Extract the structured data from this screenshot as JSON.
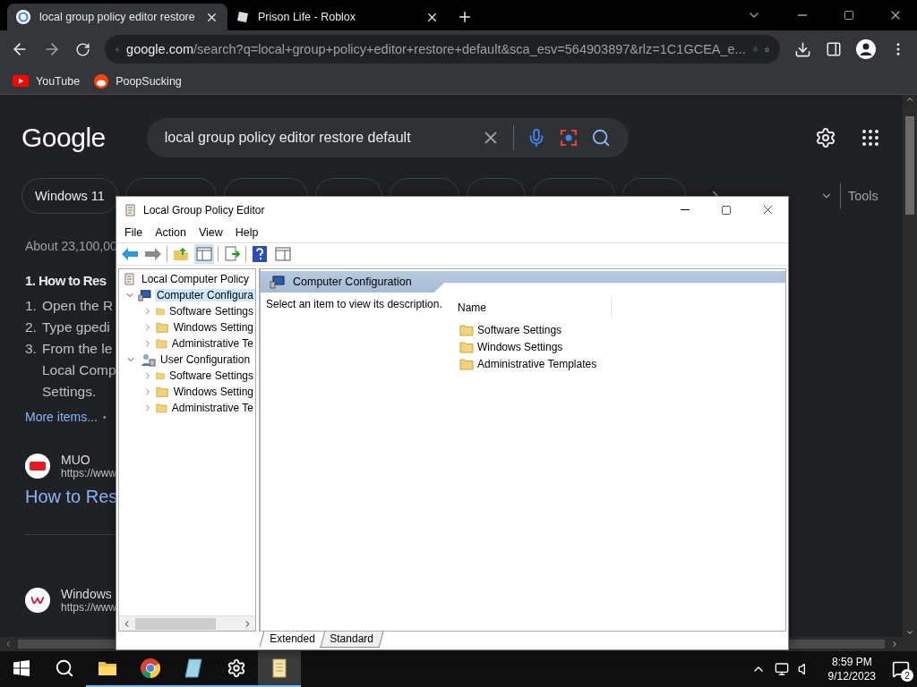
{
  "browser": {
    "tabs": [
      {
        "title": "local group policy editor restore",
        "selected": true
      },
      {
        "title": "Prison Life - Roblox",
        "selected": false
      }
    ],
    "address": {
      "host": "google.com",
      "path": "/search?q=local+group+policy+editor+restore+default&sca_esv=564903897&rlz=1C1GCEA_e..."
    },
    "bookmarks": [
      {
        "label": "YouTube",
        "kind": "youtube"
      },
      {
        "label": "PoopSucking",
        "kind": "reddit"
      }
    ]
  },
  "google": {
    "logo": "Google",
    "query": "local group policy editor restore default",
    "chips": [
      {
        "label": "Windows 11"
      }
    ],
    "tools": "Tools",
    "result_stats": "About 23,100,00",
    "snippet_title": "1. How to Res",
    "steps": [
      {
        "number": "1.",
        "lines": [
          "Open the R"
        ]
      },
      {
        "number": "2.",
        "lines": [
          "Type gpedi"
        ]
      },
      {
        "number": "3.",
        "lines": [
          "From the le",
          "Local Comp",
          "Settings."
        ]
      }
    ],
    "more_items": "More items...",
    "separator": "•",
    "results": [
      {
        "site": "MUO",
        "url": "https://www",
        "title": "How to Res",
        "kind": "muo"
      },
      {
        "site": "Windows",
        "url": "https://www",
        "kind": "windows"
      }
    ]
  },
  "gpe": {
    "title": "Local Group Policy Editor",
    "menu": [
      "File",
      "Action",
      "View",
      "Help"
    ],
    "tree": [
      {
        "label": "Local Computer Policy",
        "kind": "policy",
        "children": [
          {
            "label": "Computer Configura",
            "kind": "computer",
            "expanded": true,
            "selected": true,
            "children": [
              {
                "label": "Software Settings",
                "kind": "folder",
                "expanded": false,
                "selected": false
              },
              {
                "label": "Windows Setting",
                "kind": "folder",
                "expanded": false,
                "selected": false
              },
              {
                "label": "Administrative Te",
                "kind": "folder",
                "expanded": false,
                "selected": false
              }
            ]
          },
          {
            "label": "User Configuration",
            "kind": "user",
            "expanded": true,
            "selected": false,
            "children": [
              {
                "label": "Software Settings",
                "kind": "folder",
                "expanded": false,
                "selected": false
              },
              {
                "label": "Windows Setting",
                "kind": "folder",
                "expanded": false,
                "selected": false
              },
              {
                "label": "Administrative Te",
                "kind": "folder",
                "expanded": false,
                "selected": false
              }
            ]
          }
        ]
      }
    ],
    "details_title": "Computer Configuration",
    "description": "Select an item to view its description.",
    "column": "Name",
    "items": [
      "Software Settings",
      "Windows Settings",
      "Administrative Templates"
    ],
    "view_tabs": [
      {
        "label": "Extended",
        "selected": true
      },
      {
        "label": "Standard",
        "selected": false
      }
    ]
  },
  "taskbar": {
    "apps": [
      {
        "kind": "explorer",
        "running": true,
        "active": false
      },
      {
        "kind": "chrome",
        "running": true,
        "active": false
      },
      {
        "kind": "notes",
        "running": true,
        "active": false
      },
      {
        "kind": "settings",
        "running": true,
        "active": false
      },
      {
        "kind": "scroll",
        "running": true,
        "active": true
      }
    ],
    "time": "8:59 PM",
    "date": "9/12/2023",
    "notifications": "2"
  }
}
